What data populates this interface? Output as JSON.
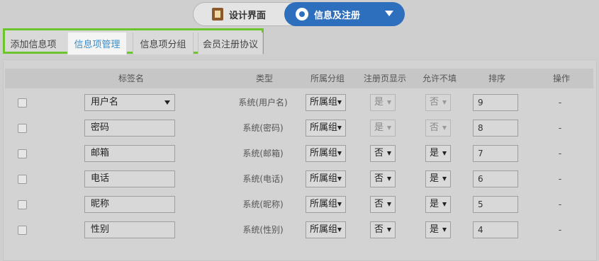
{
  "mode_switch": {
    "design_label": "设计界面",
    "info_label": "信息及注册"
  },
  "tabs": [
    {
      "label": "添加信息项"
    },
    {
      "label": "信息项管理"
    },
    {
      "label": "信息项分组"
    },
    {
      "label": "会员注册协议"
    }
  ],
  "table": {
    "headers": {
      "name": "标签名",
      "type": "类型",
      "group": "所属分组",
      "reg_show": "注册页显示",
      "allow_blank": "允许不填",
      "order": "排序",
      "op": "操作"
    },
    "rows": [
      {
        "name": "用户名",
        "name_is_select": true,
        "type": "系统(用户名)",
        "group": "所属组",
        "reg": "是",
        "reg_disabled": true,
        "allow": "否",
        "allow_disabled": true,
        "order": "9",
        "op": "-"
      },
      {
        "name": "密码",
        "type": "系统(密码)",
        "group": "所属组",
        "reg": "是",
        "reg_disabled": true,
        "allow": "否",
        "allow_disabled": true,
        "order": "8",
        "op": "-"
      },
      {
        "name": "邮箱",
        "type": "系统(邮箱)",
        "group": "所属组",
        "reg": "否",
        "allow": "是",
        "order": "7",
        "op": "-"
      },
      {
        "name": "电话",
        "type": "系统(电话)",
        "group": "所属组",
        "reg": "否",
        "allow": "是",
        "order": "6",
        "op": "-"
      },
      {
        "name": "昵称",
        "type": "系统(昵称)",
        "group": "所属组",
        "reg": "否",
        "allow": "是",
        "order": "5",
        "op": "-"
      },
      {
        "name": "性别",
        "type": "系统(性别)",
        "group": "所属组",
        "reg": "否",
        "allow": "是",
        "order": "4",
        "op": "-"
      }
    ]
  }
}
